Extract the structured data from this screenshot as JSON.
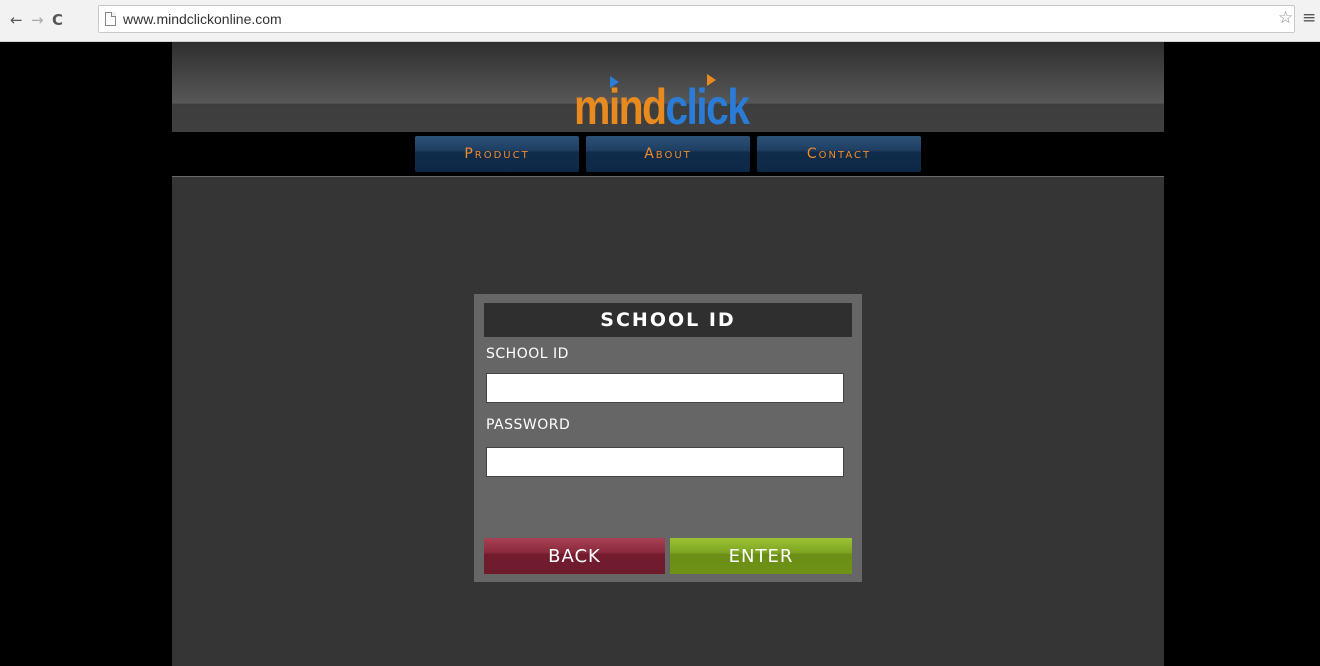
{
  "browser": {
    "url": "www.mindclickonline.com",
    "back_icon": "←",
    "forward_icon": "→",
    "reload_icon": "C",
    "star_icon": "☆",
    "menu_icon": "≡"
  },
  "logo": {
    "part1": "mind",
    "part2": "click",
    "colors": {
      "mind": "#e98a1f",
      "click": "#2a7cd6"
    }
  },
  "nav": {
    "items": [
      {
        "label": "Product"
      },
      {
        "label": "About"
      },
      {
        "label": "Contact"
      }
    ],
    "text_color": "#f28a27"
  },
  "login": {
    "title": "SCHOOL ID",
    "school_id_label": "SCHOOL ID",
    "school_id_value": "",
    "password_label": "PASSWORD",
    "password_value": "",
    "back_label": "BACK",
    "enter_label": "ENTER",
    "colors": {
      "back": "#7c2334",
      "enter": "#73991a"
    }
  }
}
